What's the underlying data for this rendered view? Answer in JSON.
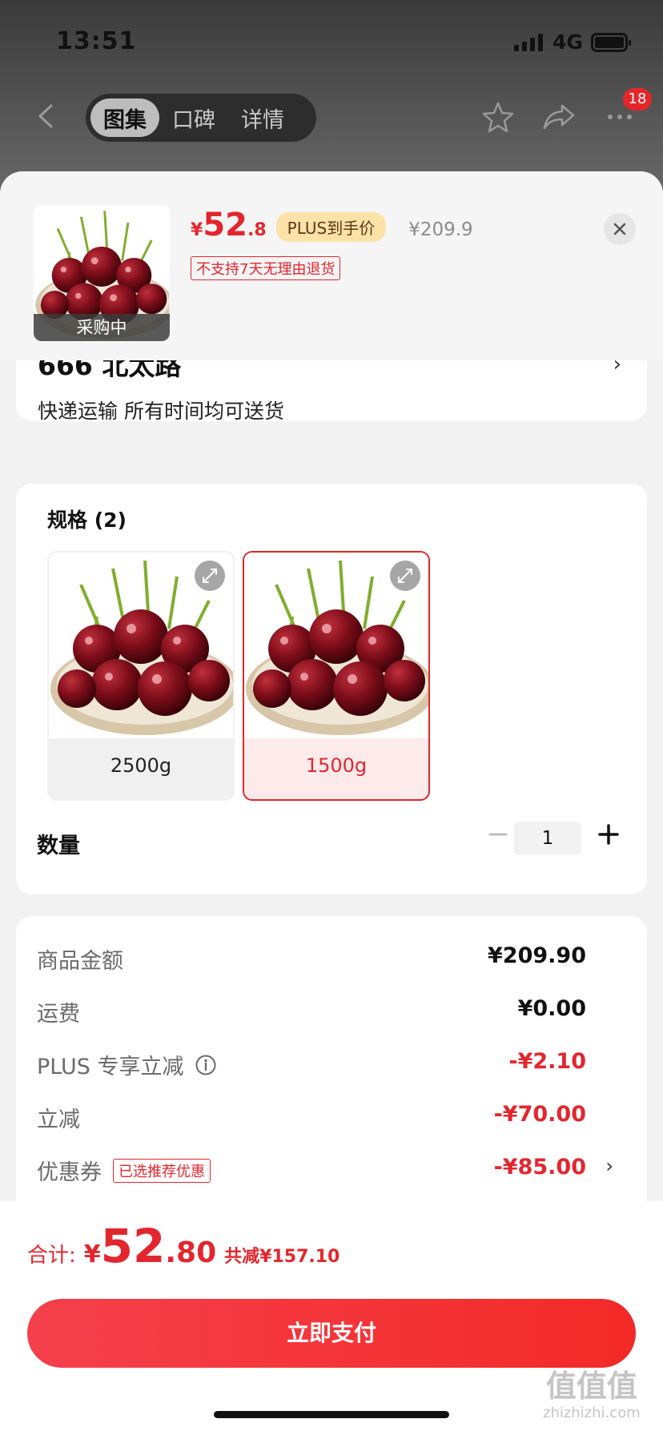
{
  "status_bar": {
    "time": "13:51",
    "network": "4G"
  },
  "nav": {
    "tabs": [
      {
        "label": "图集",
        "active": true
      },
      {
        "label": "口碑",
        "active": false
      },
      {
        "label": "详情",
        "active": false
      }
    ],
    "cart_count": "18"
  },
  "product": {
    "thumb_label": "采购中",
    "price_symbol": "¥",
    "price_int": "52",
    "price_dec": ".8",
    "plus_tag": "PLUS到手价",
    "original_price": "¥209.9",
    "return_policy": "不支持7天无理由退货"
  },
  "address": {
    "title": "666 北太路",
    "delivery": "快递运输 所有时间均可送货"
  },
  "spec": {
    "title": "规格 (2)",
    "options": [
      {
        "label": "2500g",
        "selected": false
      },
      {
        "label": "1500g",
        "selected": true
      }
    ]
  },
  "quantity": {
    "label": "数量",
    "value": "1"
  },
  "costs": [
    {
      "label": "商品金额",
      "value": "¥209.90",
      "red": false
    },
    {
      "label": "运费",
      "value": "¥0.00",
      "red": false
    },
    {
      "label": "PLUS 专享立减",
      "value": "-¥2.10",
      "red": true
    },
    {
      "label": "立减",
      "value": "-¥70.00",
      "red": true
    },
    {
      "label": "优惠券",
      "tag": "已选推荐优惠",
      "value": "-¥85.00",
      "red": true
    }
  ],
  "footer": {
    "total_label": "合计:",
    "total_symbol": "¥",
    "total_int": "52",
    "total_dec": ".80",
    "saved": "共减¥157.10",
    "pay_label": "立即支付"
  },
  "watermark": {
    "main": "值值值",
    "sub": "zhizhizhi.com"
  },
  "colors": {
    "accent_red": "#e3262e",
    "plus_gold": "#fbe3a8",
    "background": "#f2f2f2"
  }
}
